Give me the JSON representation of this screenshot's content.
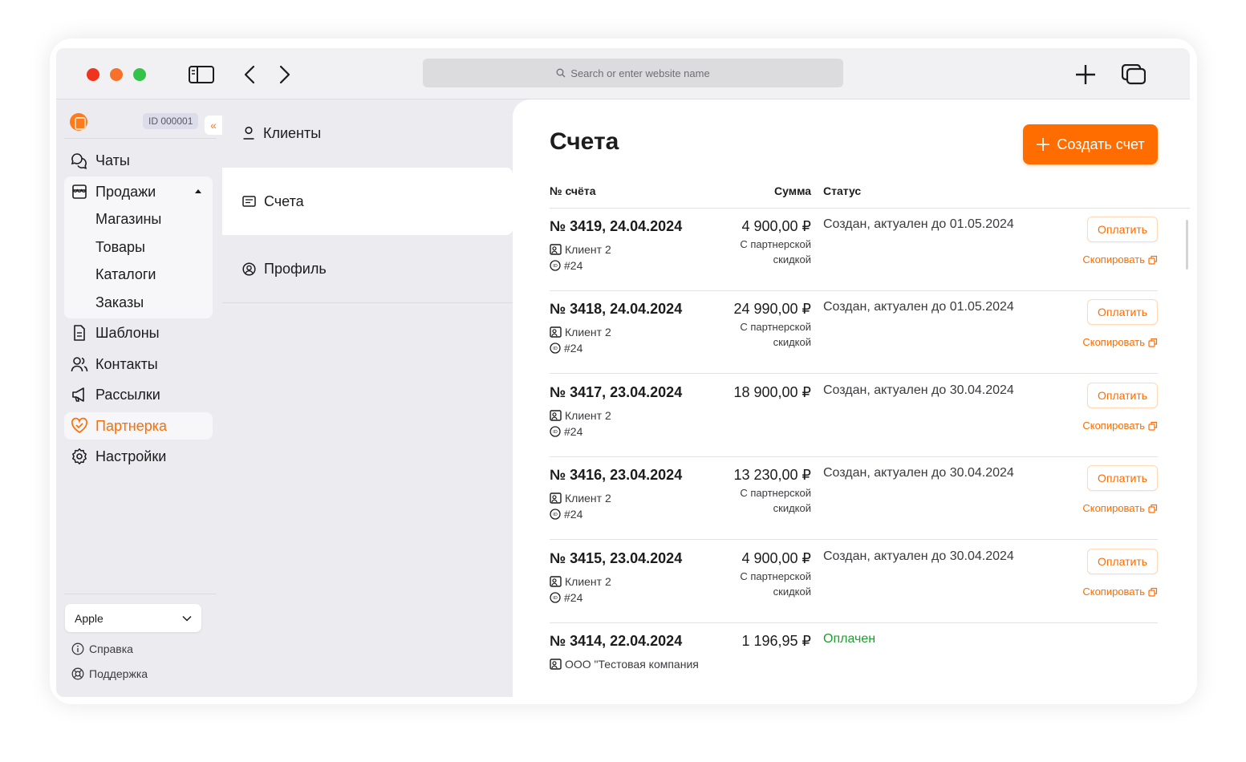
{
  "browser": {
    "address_placeholder": "Search or enter website name"
  },
  "sidebar": {
    "account_id": "ID 000001",
    "collapse_glyph": "«",
    "items": [
      {
        "label": "Чаты",
        "icon": "chat-icon"
      },
      {
        "label": "Продажи",
        "icon": "store-icon",
        "expanded": true,
        "children": [
          "Магазины",
          "Товары",
          "Каталоги",
          "Заказы"
        ]
      },
      {
        "label": "Шаблоны",
        "icon": "document-icon"
      },
      {
        "label": "Контакты",
        "icon": "users-icon"
      },
      {
        "label": "Рассылки",
        "icon": "megaphone-icon"
      },
      {
        "label": "Партнерка",
        "icon": "heart-handshake-icon",
        "active": true
      },
      {
        "label": "Настройки",
        "icon": "gear-icon"
      }
    ],
    "workspace_select": "Apple",
    "footer": {
      "help": "Справка",
      "support": "Поддержка"
    }
  },
  "subnav": {
    "items": [
      {
        "label": "Клиенты",
        "icon": "person-icon"
      },
      {
        "label": "Счета",
        "icon": "invoice-icon",
        "active": true
      },
      {
        "label": "Профиль",
        "icon": "profile-circle-icon"
      }
    ]
  },
  "main": {
    "title": "Счета",
    "create_button": "Создать счет",
    "columns": {
      "number": "№ счёта",
      "amount": "Сумма",
      "status": "Статус"
    },
    "pay_label": "Оплатить",
    "copy_label": "Скопировать",
    "invoices": [
      {
        "title": "№ 3419, 24.04.2024",
        "client": "Клиент 2",
        "ref": "#24",
        "amount": "4 900,00 ₽",
        "discount": "С партнерской скидкой",
        "status": "Создан, актуален до 01.05.2024",
        "paid": false
      },
      {
        "title": "№ 3418, 24.04.2024",
        "client": "Клиент 2",
        "ref": "#24",
        "amount": "24 990,00 ₽",
        "discount": "С партнерской скидкой",
        "status": "Создан, актуален до 01.05.2024",
        "paid": false
      },
      {
        "title": "№ 3417, 23.04.2024",
        "client": "Клиент 2",
        "ref": "#24",
        "amount": "18 900,00 ₽",
        "discount": "",
        "status": "Создан, актуален до 30.04.2024",
        "paid": false
      },
      {
        "title": "№ 3416, 23.04.2024",
        "client": "Клиент 2",
        "ref": "#24",
        "amount": "13 230,00 ₽",
        "discount": "С партнерской скидкой",
        "status": "Создан, актуален до 30.04.2024",
        "paid": false
      },
      {
        "title": "№ 3415, 23.04.2024",
        "client": "Клиент 2",
        "ref": "#24",
        "amount": "4 900,00 ₽",
        "discount": "С партнерской скидкой",
        "status": "Создан, актуален до 30.04.2024",
        "paid": false
      },
      {
        "title": "№ 3414, 22.04.2024",
        "client": "ООО \"Тестовая компания",
        "ref": "",
        "amount": "1 196,95 ₽",
        "discount": "",
        "status": "Оплачен",
        "paid": true
      }
    ]
  },
  "colors": {
    "accent": "#ff6d00",
    "paid": "#1f9d2e"
  }
}
